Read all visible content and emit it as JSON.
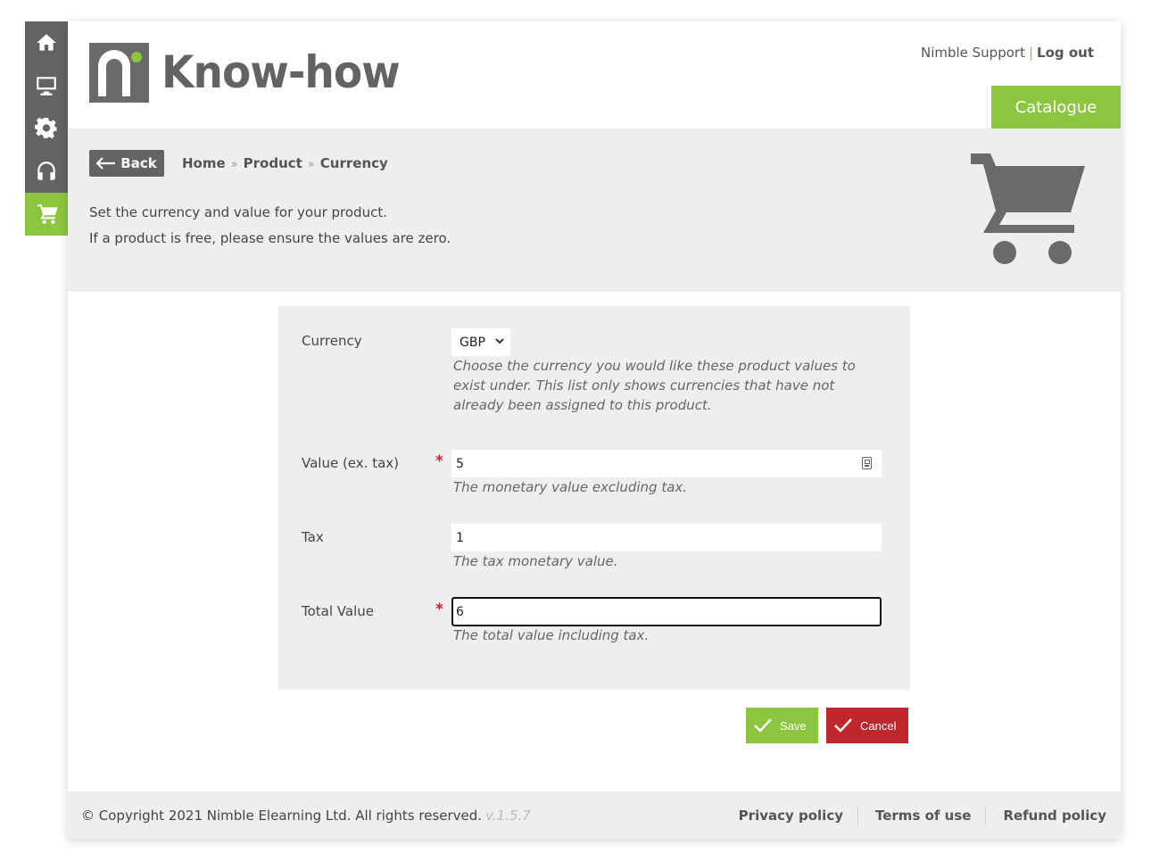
{
  "header": {
    "logo_text": "Know-how",
    "support_link": "Nimble Support",
    "separator": "|",
    "logout_link": "Log out",
    "catalogue_tab": "Catalogue"
  },
  "rail": {
    "items": [
      "home-icon",
      "monitor-icon",
      "gear-icon",
      "headset-icon",
      "cart-icon"
    ],
    "active": "cart-icon"
  },
  "nav": {
    "back_label": "Back",
    "breadcrumb": [
      "Home",
      "Product",
      "Currency"
    ],
    "breadcrumb_separator": "»"
  },
  "intro": {
    "line1": "Set the currency and value for your product.",
    "line2": "If a product is free, please ensure the values are zero."
  },
  "form": {
    "currency": {
      "label": "Currency",
      "selected": "GBP",
      "help": "Choose the currency you would like these product values to exist under. This list only shows currencies that have not already been assigned to this product."
    },
    "value_ex_tax": {
      "label": "Value (ex. tax)",
      "required_mark": "*",
      "value": "5",
      "help": "The monetary value excluding tax."
    },
    "tax": {
      "label": "Tax",
      "value": "1",
      "help": "The tax monetary value."
    },
    "total_value": {
      "label": "Total Value",
      "required_mark": "*",
      "value": "6",
      "help": "The total value including tax."
    }
  },
  "actions": {
    "save_label": "Save",
    "cancel_label": "Cancel"
  },
  "footer": {
    "copyright": "© Copyright 2021 Nimble Elearning Ltd. All rights reserved.",
    "version": "v.1.5.7",
    "links": [
      "Privacy policy",
      "Terms of use",
      "Refund policy"
    ]
  },
  "colors": {
    "accent_green": "#8cc63f",
    "dark_gray": "#636363",
    "cancel_red": "#c0272d",
    "band_gray": "#eeeeee"
  }
}
